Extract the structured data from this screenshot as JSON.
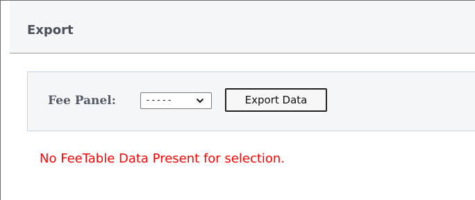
{
  "header": {
    "title": "Export"
  },
  "filter": {
    "fee_panel_label": "Fee Panel:",
    "fee_panel_selected": "-----",
    "export_button_label": "Export Data"
  },
  "status": {
    "message": "No FeeTable Data Present for selection.",
    "message_color": "#ff0000"
  },
  "icons": {
    "select_arrow": "chevron-down-icon"
  }
}
